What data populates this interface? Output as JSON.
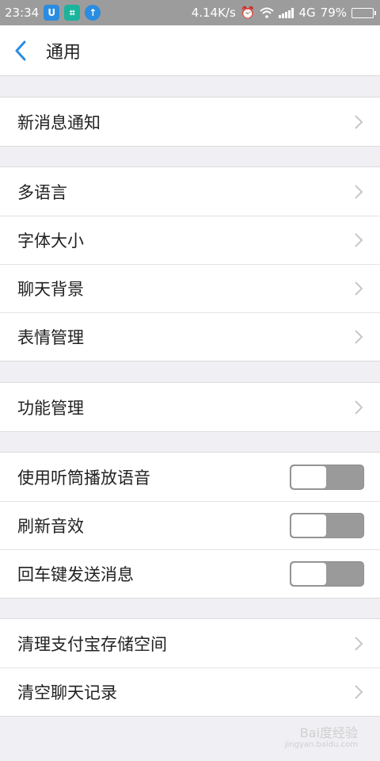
{
  "status_bar": {
    "time": "23:34",
    "net_speed": "4.14K/s",
    "network": "4G",
    "battery": "79%",
    "battery_level": 0.79,
    "icons": [
      "notification-u-icon",
      "scan-icon",
      "upload-arrow-icon",
      "alarm-icon",
      "wifi-icon",
      "signal-icon",
      "battery-icon"
    ]
  },
  "header": {
    "title": "通用"
  },
  "groups": [
    {
      "items": [
        {
          "label": "新消息通知",
          "type": "link"
        }
      ]
    },
    {
      "items": [
        {
          "label": "多语言",
          "type": "link"
        },
        {
          "label": "字体大小",
          "type": "link"
        },
        {
          "label": "聊天背景",
          "type": "link"
        },
        {
          "label": "表情管理",
          "type": "link"
        }
      ]
    },
    {
      "items": [
        {
          "label": "功能管理",
          "type": "link"
        }
      ]
    },
    {
      "items": [
        {
          "label": "使用听筒播放语音",
          "type": "toggle",
          "on": false
        },
        {
          "label": "刷新音效",
          "type": "toggle",
          "on": false
        },
        {
          "label": "回车键发送消息",
          "type": "toggle",
          "on": false
        }
      ]
    },
    {
      "items": [
        {
          "label": "清理支付宝存储空间",
          "type": "link"
        },
        {
          "label": "清空聊天记录",
          "type": "link"
        }
      ]
    }
  ],
  "watermark": {
    "line1": "Bai度经验",
    "line2": "jingyan.baidu.com"
  },
  "colors": {
    "accent": "#2a8de0",
    "background": "#efeff4",
    "toggle_off": "#9a9a9a"
  }
}
